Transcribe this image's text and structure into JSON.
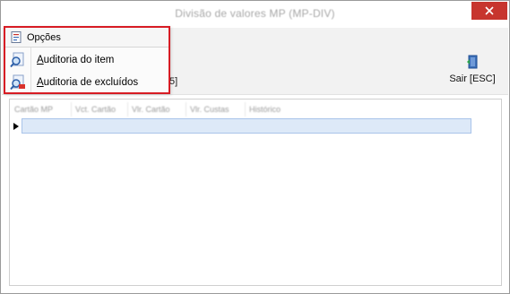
{
  "window": {
    "title": "Divisão de valores MP (MP-DIV)"
  },
  "toolbar": {
    "partial_label": "5]",
    "exit_label": "Sair [ESC]"
  },
  "menu": {
    "header_label": "Opções",
    "items": [
      {
        "label_first": "A",
        "label_rest": "uditoria do item",
        "icon": "magnifier-icon"
      },
      {
        "label_first": "A",
        "label_rest": "uditoria de excluídos",
        "icon": "deleted-audit-icon"
      }
    ]
  },
  "grid": {
    "columns": [
      "Cartão MP",
      "Vct. Cartão",
      "Vlr. Cartão",
      "Vlr. Custas",
      "Histórico"
    ]
  },
  "colors": {
    "accent_border": "#d71c24",
    "close_button": "#c7352e",
    "selected_row": "#dde9f8"
  }
}
